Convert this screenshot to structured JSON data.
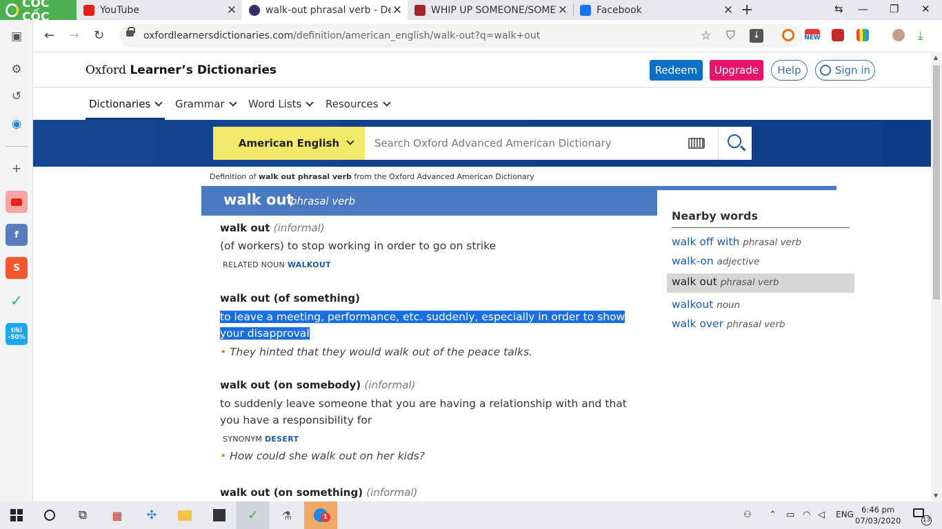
{
  "browser": {
    "brand": "CỐC CỐC",
    "tabs": [
      {
        "title": "YouTube",
        "icon": "youtube-icon",
        "active": false
      },
      {
        "title": "walk-out phrasal verb - Defini",
        "icon": "oxford-icon",
        "active": true
      },
      {
        "title": "WHIP UP SOMEONE/SOMETH",
        "icon": "cambridge-icon",
        "active": false
      },
      {
        "title": "Facebook",
        "icon": "facebook-icon",
        "active": false
      }
    ],
    "url_host": "oxfordlearnersdictionaries.com",
    "url_path": "/definition/american_english/walk-out?q=walk+out",
    "extension_badge": "NEW"
  },
  "sidebar_apps": {
    "tiki_top": "tiki",
    "tiki_bottom": "-50%"
  },
  "site": {
    "logo_prefix": "Oxford",
    "logo_main": "Learner’s Dictionaries",
    "buttons": {
      "redeem": "Redeem",
      "upgrade": "Upgrade",
      "help": "Help",
      "signin": "Sign in"
    },
    "menu": [
      "Dictionaries",
      "Grammar",
      "Word Lists",
      "Resources"
    ],
    "dictionary_select": "American English",
    "search_placeholder": "Search Oxford Advanced American Dictionary"
  },
  "breadcrumb": {
    "prefix": "Definition of ",
    "term": "walk out phrasal verb",
    "suffix": " from the Oxford Advanced American Dictionary"
  },
  "headword": {
    "word": "walk out",
    "pos": "phrasal verb"
  },
  "senses": [
    {
      "pv": "walk out",
      "register": "informal",
      "definition": "(of workers) to stop working in order to go on strike",
      "xref_label": "RELATED NOUN",
      "xref_link": "WALKOUT"
    },
    {
      "pv": "walk out",
      "paren": "(of something)",
      "definition_selected": "to leave a meeting, performance, etc. suddenly, especially in order to show your disapproval",
      "example": "They hinted that they would walk out of the peace talks."
    },
    {
      "pv": "walk out (on somebody)",
      "register": "informal",
      "definition": "to suddenly leave someone that you are having a relationship with and that you have a responsibility for",
      "xref_label": "SYNONYM",
      "xref_link": "DESERT",
      "example": "How could she walk out on her kids?"
    },
    {
      "pv": "walk out (on something)",
      "register": "informal"
    }
  ],
  "nearby": {
    "title": "Nearby words",
    "items": [
      {
        "word": "walk off with",
        "pos": "phrasal verb",
        "current": false
      },
      {
        "word": "walk-on",
        "pos": "adjective",
        "current": false
      },
      {
        "word": "walk out",
        "pos": "phrasal verb",
        "current": true
      },
      {
        "word": "walkout",
        "pos": "noun",
        "current": false
      },
      {
        "word": "walk over",
        "pos": "phrasal verb",
        "current": false
      }
    ]
  },
  "taskbar": {
    "language": "ENG",
    "time": "6:46 pm",
    "date": "07/03/2020",
    "notification_count": "13",
    "zalo_badge": "1"
  },
  "colors": {
    "oxford_blue": "#0d3c88",
    "yellow": "#f3e86a",
    "redeem": "#0e6fc4",
    "upgrade": "#e6156b",
    "selection": "#1a6fe0",
    "coccoc_green": "#4caf50"
  }
}
